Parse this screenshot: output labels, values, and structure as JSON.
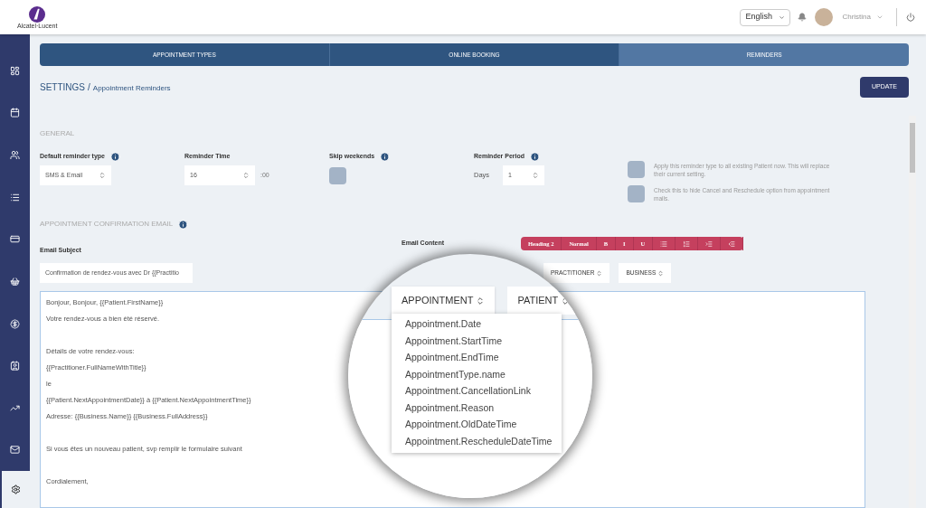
{
  "header": {
    "logo_text": "Alcatel·Lucent",
    "language": "English",
    "user_name": "Christina"
  },
  "sidebar": {
    "items": [
      {
        "selected": false
      },
      {
        "selected": false
      },
      {
        "selected": false
      },
      {
        "selected": false
      },
      {
        "selected": false
      },
      {
        "selected": false
      },
      {
        "selected": false
      },
      {
        "selected": false
      },
      {
        "selected": false
      },
      {
        "selected": false
      },
      {
        "selected": true
      }
    ]
  },
  "tabs": [
    {
      "label": "APPOINTMENT TYPES",
      "selected": false
    },
    {
      "label": "ONLINE BOOKING",
      "selected": false
    },
    {
      "label": "REMINDERS",
      "selected": true
    }
  ],
  "breadcrumb": {
    "title": "SETTINGS",
    "separator": "/",
    "page": "Appointment Reminders"
  },
  "update_button": "UPDATE",
  "general": {
    "heading": "GENERAL",
    "default_reminder_type": {
      "label": "Default reminder type",
      "value": "SMS & Email"
    },
    "reminder_time": {
      "label": "Reminder Time",
      "value": "16",
      "suffix": ":00"
    },
    "skip_weekends": {
      "label": "Skip weekends",
      "checked": false
    },
    "reminder_period": {
      "label": "Reminder Period",
      "unit": "Days",
      "value": "1"
    },
    "options": [
      {
        "text": "Apply this reminder type to all existing Patient now. This will replace their current setting.",
        "checked": false
      },
      {
        "text": "Check this to hide Cancel and Reschedule option from appointment mails.",
        "checked": false
      }
    ]
  },
  "confirmation_email": {
    "heading": "APPOINTMENT CONFIRMATION EMAIL",
    "subject_label": "Email Subject",
    "subject": "Confirmation de rendez-vous avec Dr {{Practitio",
    "content_label": "Email Content",
    "toolbar": [
      {
        "kind": "text",
        "label": "Heading 2"
      },
      {
        "kind": "text",
        "label": "Normal"
      },
      {
        "kind": "text",
        "label": "B"
      },
      {
        "kind": "text",
        "label": "I"
      },
      {
        "kind": "text",
        "label": "U"
      },
      {
        "kind": "bullets"
      },
      {
        "kind": "numbers"
      },
      {
        "kind": "indent"
      },
      {
        "kind": "outdent"
      }
    ],
    "placeholder_buttons": [
      "PRACTITIONER",
      "BUSINESS"
    ],
    "body": [
      [
        "Bonjour, Bonjour, {{Patient.FirstName}}",
        "Votre rendez-vous a bien été réservé."
      ],
      [
        "Détails de votre rendez-vous:",
        "{{Practitioner.FullNameWithTitle}}",
        "le",
        "{{Patient.NextAppointmentDate}} à {{Patient.NextAppointmentTime}}",
        "Adresse: {{Business.Name}} {{Business.FullAddress}}"
      ],
      [
        "Si vous êtes un nouveau patient, svp remplir le formulaire suivant"
      ],
      [
        "Cordialement,"
      ]
    ]
  },
  "magnifier": {
    "buttons": [
      {
        "label": "APPOINTMENT",
        "expanded": true
      },
      {
        "label": "PATIENT",
        "expanded": false
      }
    ],
    "menu": [
      "Appointment.Date",
      "Appointment.StartTime",
      "Appointment.EndTime",
      "AppointmentType.name",
      "Appointment.CancellationLink",
      "Appointment.Reason",
      "Appointment.OldDateTime",
      "Appointment.RescheduleDateTime"
    ]
  }
}
